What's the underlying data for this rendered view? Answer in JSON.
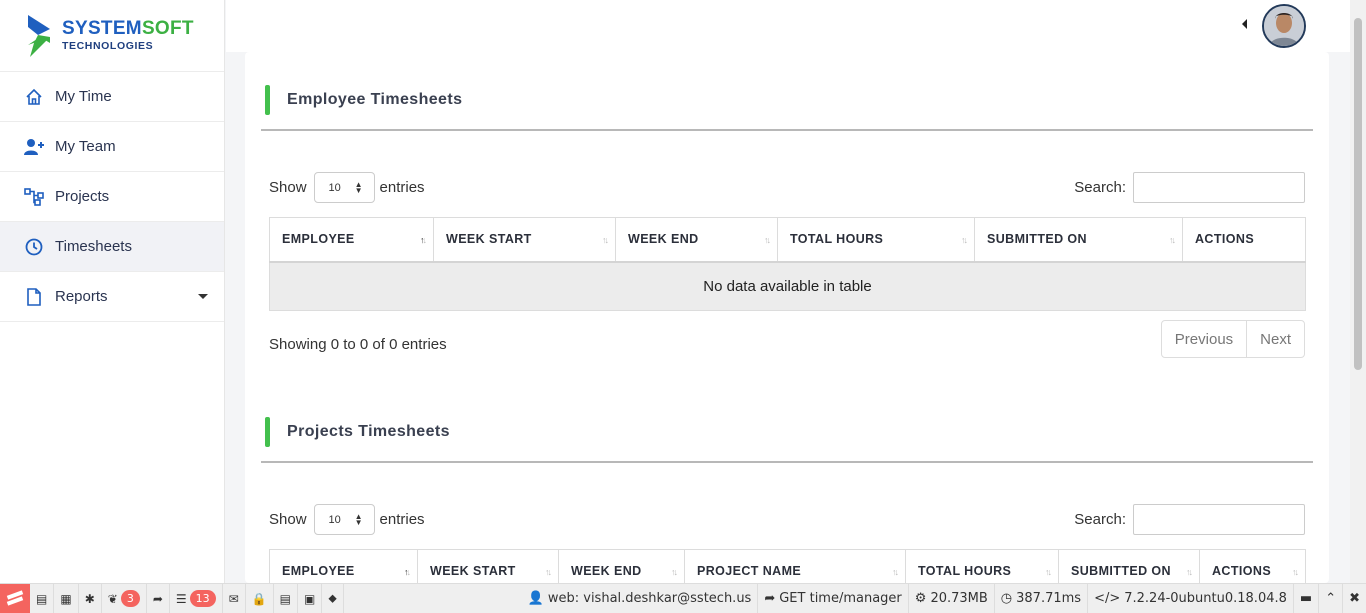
{
  "brand": {
    "title_blue": "SYSTEM",
    "title_green": "SOFT",
    "subtitle": "TECHNOLOGIES"
  },
  "sidebar": {
    "items": [
      {
        "label": "My Time",
        "icon": "home-icon"
      },
      {
        "label": "My Team",
        "icon": "user-plus-icon"
      },
      {
        "label": "Projects",
        "icon": "sitemap-icon"
      },
      {
        "label": "Timesheets",
        "icon": "clock-icon",
        "active": true
      },
      {
        "label": "Reports",
        "icon": "file-icon",
        "dropdown": true
      }
    ]
  },
  "employee": {
    "title": "Employee Timesheets",
    "show_label": "Show",
    "entries_value": "10",
    "entries_label": "entries",
    "search_label": "Search:",
    "columns": [
      "EMPLOYEE",
      "WEEK START",
      "WEEK END",
      "TOTAL HOURS",
      "SUBMITTED ON",
      "ACTIONS"
    ],
    "empty_message": "No data available in table",
    "info": "Showing 0 to 0 of 0 entries",
    "prev_label": "Previous",
    "next_label": "Next"
  },
  "projects": {
    "title": "Projects Timesheets",
    "show_label": "Show",
    "entries_value": "10",
    "entries_label": "entries",
    "search_label": "Search:",
    "columns": [
      "EMPLOYEE",
      "WEEK START",
      "WEEK END",
      "PROJECT NAME",
      "TOTAL HOURS",
      "SUBMITTED ON",
      "ACTIONS"
    ]
  },
  "debugbar": {
    "badge_logs": "3",
    "badge_queries": "13",
    "user": "web: vishal.deshkar@sstech.us",
    "route": "GET time/manager",
    "memory": "20.73MB",
    "time": "387.71ms",
    "php": "7.2.24-0ubuntu0.18.04.8"
  },
  "colors": {
    "accent_green": "#43c04d",
    "brand_blue": "#1f5fbf",
    "badge_red": "#f4645f"
  }
}
